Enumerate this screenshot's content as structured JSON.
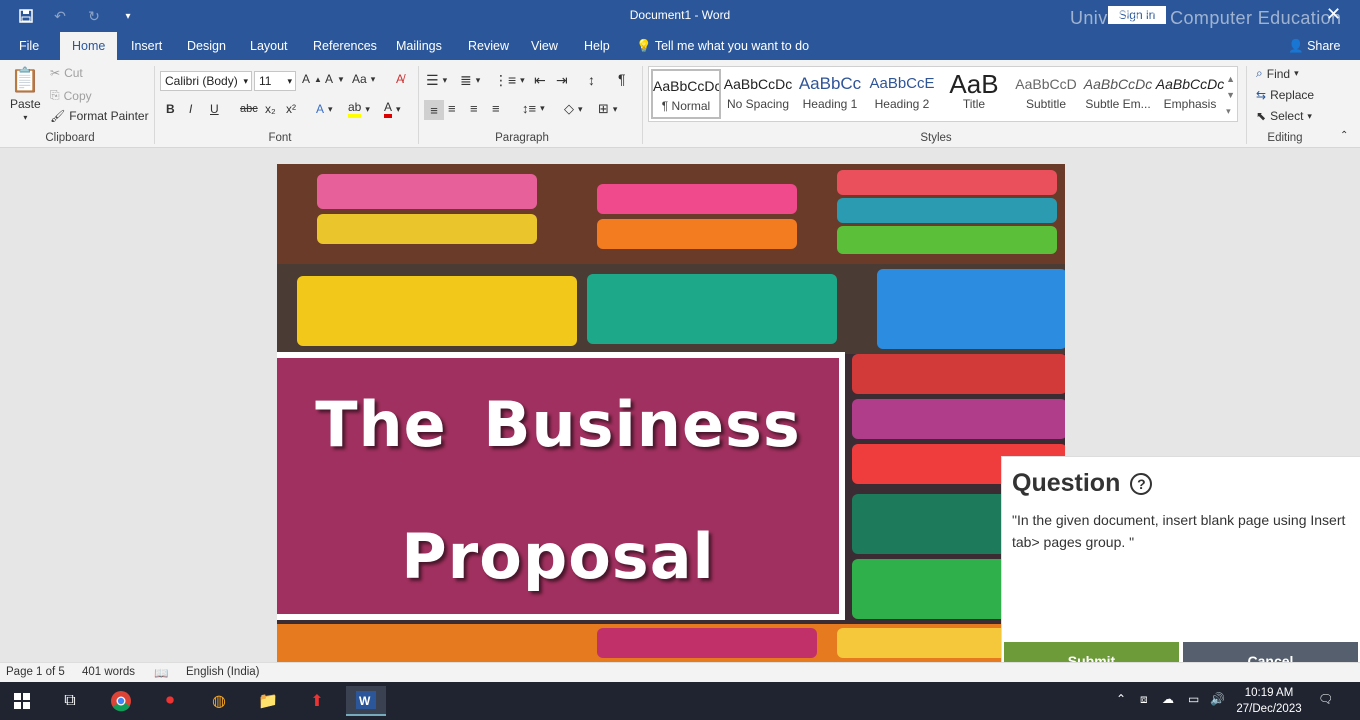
{
  "titlebar": {
    "doc_title": "Document1  -  Word",
    "sign_in": "Sign in",
    "watermark": "UniveBan’s Computer Education"
  },
  "tabs": [
    "File",
    "Home",
    "Insert",
    "Design",
    "Layout",
    "References",
    "Mailings",
    "Review",
    "View",
    "Help"
  ],
  "active_tab": "Home",
  "tell_me": "Tell me what you want to do",
  "share": "Share",
  "clipboard": {
    "paste": "Paste",
    "cut": "Cut",
    "copy": "Copy",
    "format_painter": "Format Painter",
    "label": "Clipboard"
  },
  "font": {
    "name": "Calibri (Body)",
    "size": "11",
    "label": "Font",
    "bold": "B",
    "italic": "I",
    "underline": "U",
    "strike": "abc",
    "sub": "x₂",
    "sup": "x²",
    "case": "Aa"
  },
  "paragraph": {
    "label": "Paragraph"
  },
  "styles": {
    "label": "Styles",
    "items": [
      {
        "preview": "AaBbCcDc",
        "name": "¶ Normal"
      },
      {
        "preview": "AaBbCcDc",
        "name": "No Spacing"
      },
      {
        "preview": "AaBbCc",
        "name": "Heading 1"
      },
      {
        "preview": "AaBbCcE",
        "name": "Heading 2"
      },
      {
        "preview": "AaB",
        "name": "Title"
      },
      {
        "preview": "AaBbCcD",
        "name": "Subtitle"
      },
      {
        "preview": "AaBbCcDc",
        "name": "Subtle Em..."
      },
      {
        "preview": "AaBbCcDc",
        "name": "Emphasis"
      }
    ]
  },
  "editing": {
    "find": "Find",
    "replace": "Replace",
    "select": "Select",
    "label": "Editing"
  },
  "document": {
    "title_line1": "The  Business",
    "title_line2": "Proposal"
  },
  "question": {
    "title": "Question",
    "text": "\"In the given document, insert blank page using Insert tab> pages group. \"",
    "submit": "Submit",
    "cancel": "Cancel"
  },
  "status": {
    "page": "Page 1 of 5",
    "words": "401 words",
    "language": "English (India)"
  },
  "taskbar": {
    "time": "10:19 AM",
    "date": "27/Dec/2023"
  },
  "colors": {
    "word_blue": "#2b579a",
    "title_box": "#a0305f",
    "submit": "#6e9b3a",
    "cancel": "#555f6d"
  }
}
